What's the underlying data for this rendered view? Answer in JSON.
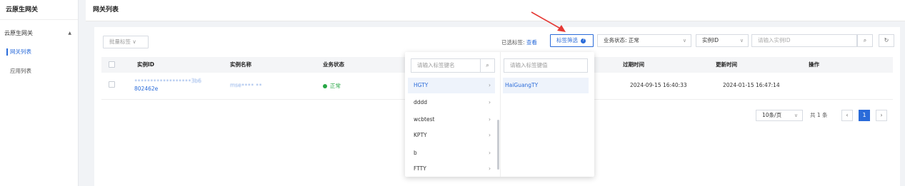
{
  "sidebar": {
    "brand": "云原生网关",
    "group_label": "云原生网关",
    "items": [
      {
        "label": "网关列表",
        "active": true
      },
      {
        "label": "应用列表",
        "active": false
      }
    ]
  },
  "header": {
    "title": "网关列表"
  },
  "toolbar": {
    "batch_tag_label": "批量标签 ∨",
    "selected_tags_label": "已选标签:",
    "view_link": "查看",
    "tag_filter_label": "标签筛选",
    "business_status_label": "业务状态: 正常",
    "instance_field_label": "实例ID",
    "instance_search_placeholder": "请输入实例ID",
    "refresh_icon": "refresh-icon",
    "search_icon": "search-icon"
  },
  "table": {
    "columns": [
      "实例ID",
      "实例名称",
      "业务状态",
      "过期时间",
      "更新时间",
      "操作"
    ],
    "rows": [
      {
        "instance_id_line1": "••••••••••••••••••3b6",
        "instance_id_line2": "802462e",
        "instance_name": "mse•••• ••",
        "status": "正常",
        "expire_time": "2024-09-15 16:40:33",
        "update_time": "2024-01-15 16:47:14"
      }
    ]
  },
  "pagination": {
    "page_size": "10条/页",
    "total": "共 1 条",
    "current_page": "1"
  },
  "tag_dropdown": {
    "key_placeholder": "请输入标签键名",
    "value_placeholder": "请输入标签键值",
    "keys": [
      "HGTY",
      "dddd",
      "wcbtest",
      "KPTY",
      "b",
      "FTTY"
    ],
    "selected_key_index": 0,
    "values": [
      "HaiGuangTY"
    ]
  },
  "colors": {
    "accent": "#2a6bd9",
    "status_ok": "#27a745",
    "annotation_arrow": "#e53935"
  }
}
